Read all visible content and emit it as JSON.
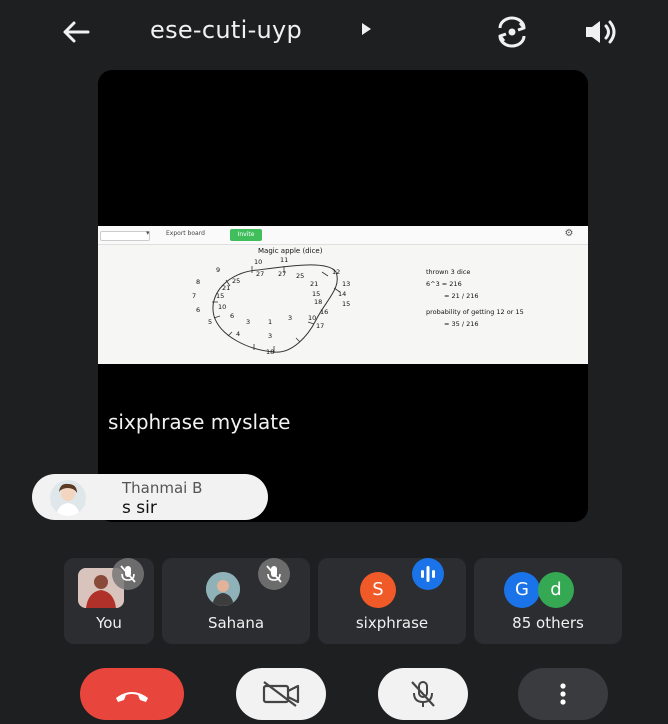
{
  "header": {
    "meeting_code": "ese-cuti-uyp",
    "back_icon": "arrow-left-icon",
    "switch_camera_icon": "switch-camera-icon",
    "audio_icon": "speaker-icon"
  },
  "stage": {
    "label": "sixphrase myslate",
    "presentation": {
      "toolbar": {
        "export_label": "Export board",
        "invite_label": "Invite"
      },
      "title": "Magic  apple (dice)",
      "diagram_numbers": [
        "10",
        "11",
        "9",
        "27",
        "27",
        "25",
        "12",
        "25",
        "8",
        "21",
        "21",
        "13",
        "15",
        "14",
        "7",
        "15",
        "18",
        "15",
        "10",
        "6",
        "16",
        "6",
        "10",
        "5",
        "3",
        "3",
        "1",
        "17",
        "4",
        "3",
        "18"
      ],
      "notes": {
        "line1": "thrown 3 dice",
        "line2": "6^3 = 216",
        "line3": "= 21 / 216",
        "line4": "probability of getting 12 or 15",
        "line5": "= 35 / 216"
      }
    }
  },
  "chat_bubble": {
    "name": "Thanmai B",
    "message": "s sir"
  },
  "participants": [
    {
      "label": "You",
      "muted": true
    },
    {
      "label": "Sahana",
      "muted": true
    },
    {
      "label": "sixphrase",
      "initial": "S",
      "color": "#f05a28",
      "speaking": true
    },
    {
      "label": "85 others",
      "initials": [
        "G",
        "d"
      ],
      "colors": [
        "#1a73e8",
        "#34a853"
      ]
    }
  ],
  "controls": {
    "end_call_icon": "phone-hangup-icon",
    "camera_icon": "camera-off-icon",
    "mic_icon": "mic-off-icon",
    "more_icon": "more-vertical-icon"
  },
  "colors": {
    "background": "#1e1f21",
    "tile": "#2c2d30",
    "end_call": "#e8453c",
    "speaking": "#1a73e8"
  }
}
